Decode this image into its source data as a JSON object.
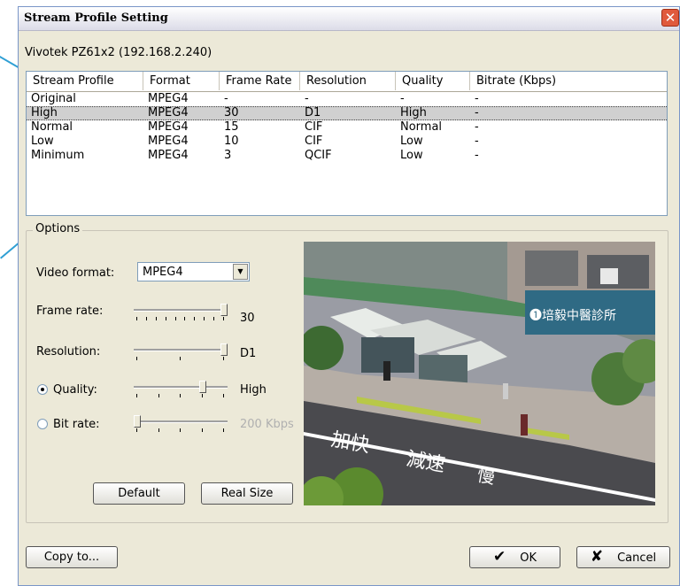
{
  "dialog": {
    "title": "Stream Profile Setting",
    "close_icon": "close-icon"
  },
  "device": {
    "label": "Vivotek PZ61x2 (192.168.2.240)"
  },
  "profile_list": {
    "columns": [
      "Stream Profile",
      "Format",
      "Frame Rate",
      "Resolution",
      "Quality",
      "Bitrate (Kbps)"
    ],
    "rows": [
      [
        "Original",
        "MPEG4",
        "-",
        "-",
        "-",
        "-"
      ],
      [
        "High",
        "MPEG4",
        "30",
        "D1",
        "High",
        "-"
      ],
      [
        "Normal",
        "MPEG4",
        "15",
        "CIF",
        "Normal",
        "-"
      ],
      [
        "Low",
        "MPEG4",
        "10",
        "CIF",
        "Low",
        "-"
      ],
      [
        "Minimum",
        "MPEG4",
        "3",
        "QCIF",
        "Low",
        "-"
      ]
    ],
    "selected_row": 1
  },
  "options": {
    "group_label": "Options",
    "video_format": {
      "label": "Video format:",
      "value": "MPEG4"
    },
    "frame_rate": {
      "label": "Frame rate:",
      "value": "30",
      "level": 1.0
    },
    "resolution": {
      "label": "Resolution:",
      "value": "D1",
      "level": 1.0
    },
    "quality": {
      "label": "Quality:",
      "value": "High",
      "level": 0.75,
      "selected": true
    },
    "bit_rate": {
      "label": "Bit rate:",
      "value": "200 Kbps",
      "level": 0.0,
      "selected": false
    },
    "default_button": "Default",
    "real_size_button": "Real Size"
  },
  "footer": {
    "copy_button": "Copy to...",
    "ok_button": "OK",
    "cancel_button": "Cancel"
  },
  "colors": {
    "window_bg": "#ece9d8",
    "selection_bg": "#d0d0d0",
    "callout_line": "#2f9fd4",
    "close_red": "#e05a3c"
  }
}
